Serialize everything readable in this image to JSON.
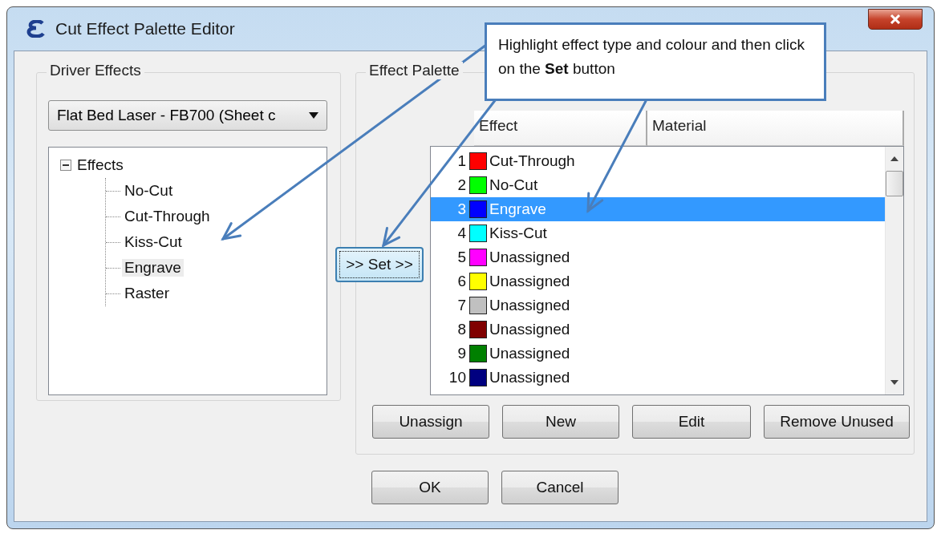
{
  "window": {
    "title": "Cut Effect Palette Editor"
  },
  "driver_effects": {
    "label": "Driver Effects",
    "dropdown": {
      "value": "Flat Bed Laser - FB700 (Sheet c"
    },
    "tree": [
      {
        "label": "Effects",
        "expanded": true,
        "children": [
          {
            "label": "No-Cut",
            "selected": false
          },
          {
            "label": "Cut-Through",
            "selected": false
          },
          {
            "label": "Kiss-Cut",
            "selected": false
          },
          {
            "label": "Engrave",
            "selected": true
          },
          {
            "label": "Raster",
            "selected": false
          }
        ]
      }
    ]
  },
  "set_button": ">> Set >>",
  "effect_palette": {
    "label": "Effect Palette",
    "columns": [
      "Effect",
      "Material"
    ],
    "rows": [
      {
        "number": "1",
        "color": "#ff0000",
        "effect": "Cut-Through",
        "selected": false
      },
      {
        "number": "2",
        "color": "#00ff00",
        "effect": "No-Cut",
        "selected": false
      },
      {
        "number": "3",
        "color": "#0000ff",
        "effect": "Engrave",
        "selected": true
      },
      {
        "number": "4",
        "color": "#00ffff",
        "effect": "Kiss-Cut",
        "selected": false
      },
      {
        "number": "5",
        "color": "#ff00ff",
        "effect": "Unassigned",
        "selected": false
      },
      {
        "number": "6",
        "color": "#ffff00",
        "effect": "Unassigned",
        "selected": false
      },
      {
        "number": "7",
        "color": "#c0c0c0",
        "effect": "Unassigned",
        "selected": false
      },
      {
        "number": "8",
        "color": "#800000",
        "effect": "Unassigned",
        "selected": false
      },
      {
        "number": "9",
        "color": "#008000",
        "effect": "Unassigned",
        "selected": false
      },
      {
        "number": "10",
        "color": "#000080",
        "effect": "Unassigned",
        "selected": false
      }
    ],
    "buttons": [
      "Unassign",
      "New",
      "Edit",
      "Remove Unused"
    ]
  },
  "dialog_buttons": [
    "OK",
    "Cancel"
  ],
  "callout": {
    "text": "Highlight effect type and colour and then click on the **Set** button"
  }
}
